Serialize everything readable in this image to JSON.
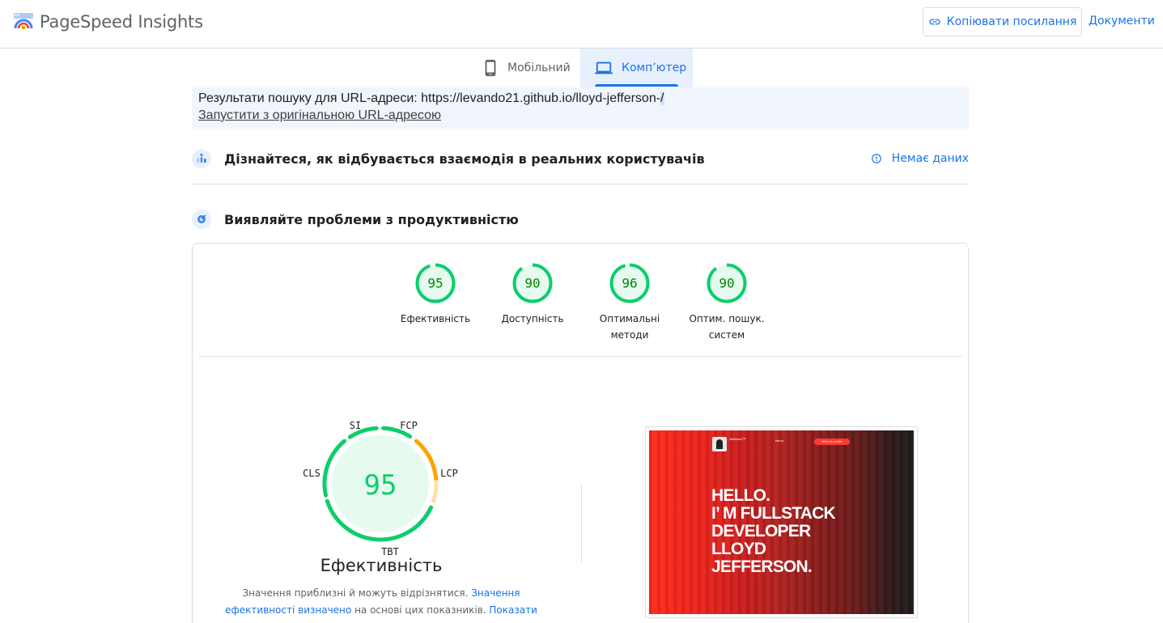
{
  "header": {
    "brand": "PageSpeed Insights",
    "copy_link_label": "Копіювати посилання",
    "docs_label": "Документи"
  },
  "tabs": [
    {
      "label": "Мобільний",
      "icon": "smartphone-icon",
      "active": false
    },
    {
      "label": "Комп’ютер",
      "icon": "laptop-icon",
      "active": true
    }
  ],
  "url_box": {
    "prefix": "Результати пошуку для URL-адреси: ",
    "url_main": "https://levando21.github.io/lloyd-jefferson-",
    "url_last": "/",
    "run_original": "Запустити з оригінальною URL-адресою"
  },
  "field_data": {
    "title": "Дізнайтеся, як відбувається взаємодія в реальних користувачів",
    "status": "Немає даних"
  },
  "diagnose": {
    "title": "Виявляйте проблеми з продуктивністю"
  },
  "scores": [
    {
      "value": "95",
      "label_line1": "Ефективність",
      "label_line2": "",
      "fraction": 0.95
    },
    {
      "value": "90",
      "label_line1": "Доступність",
      "label_line2": "",
      "fraction": 0.9
    },
    {
      "value": "96",
      "label_line1": "Оптимальні",
      "label_line2": "методи",
      "fraction": 0.96
    },
    {
      "value": "90",
      "label_line1": "Оптим. пошук.",
      "label_line2": "систем",
      "fraction": 0.9
    }
  ],
  "performance": {
    "score": "95",
    "title": "Ефективність",
    "metrics": {
      "si": "SI",
      "fcp": "FCP",
      "lcp": "LCP",
      "tbt": "TBT",
      "cls": "CLS"
    },
    "note_text1": "Значення приблизні й можуть відрізнятися. ",
    "note_link1": "Значення ефективності визначено",
    "note_text2": " на основі цих показників. ",
    "note_link2": "Показати калькулятор",
    "note_end": "."
  },
  "preview": {
    "site_name": "Jefferson™",
    "menu": "Menu",
    "button": "Write me a letter",
    "hero_lines": [
      "HELLO.",
      "I’ M FULLSTACK",
      "DEVELOPER",
      "LLOYD",
      "JEFFERSON."
    ]
  },
  "colors": {
    "pass": "#0cce6b",
    "average": "#ffa400",
    "accent": "#1a73e8"
  }
}
